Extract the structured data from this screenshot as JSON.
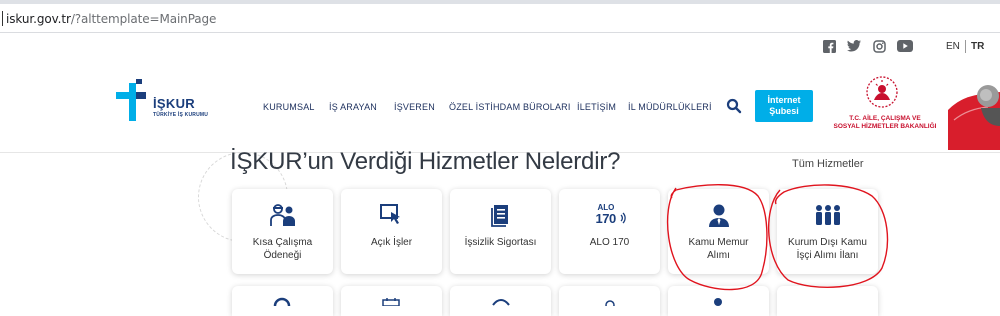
{
  "browser": {
    "url_host": "iskur.gov.tr",
    "url_path": "/?alttemplate=MainPage"
  },
  "topbar": {
    "social_icons": [
      "facebook-icon",
      "twitter-icon",
      "instagram-icon",
      "youtube-icon"
    ],
    "lang_en": "EN",
    "lang_tr": "TR"
  },
  "header": {
    "logo_word": "İŞKUR",
    "logo_sub": "TÜRKİYE İŞ KURUMU",
    "nav": [
      "KURUMSAL",
      "İŞ ARAYAN",
      "İŞVEREN",
      "ÖZEL İSTİHDAM BÜROLARI",
      "İLETİŞİM",
      "İL MÜDÜRLÜKLERİ"
    ],
    "eservice_line1": "İnternet",
    "eservice_line2": "Şubesi",
    "ministry_line1": "T.C. AİLE, ÇALIŞMA VE",
    "ministry_line2": "SOSYAL HİZMETLER BAKANLIĞI"
  },
  "main": {
    "heading": "İŞKUR’un Verdiği Hizmetler Nelerdir?",
    "all_services": "Tüm Hizmetler",
    "services": [
      {
        "line1": "Kısa Çalışma",
        "line2": "Ödeneği",
        "icon": "workers-icon"
      },
      {
        "line1": "Açık İşler",
        "line2": "",
        "icon": "cursor-click-icon"
      },
      {
        "line1": "İşsizlik Sigortası",
        "line2": "",
        "icon": "document-icon"
      },
      {
        "line1": "ALO 170",
        "line2": "",
        "icon": "alo170-icon",
        "icon_text_top": "ALO",
        "icon_text_bottom": "170"
      },
      {
        "line1": "Kamu Memur",
        "line2": "Alımı",
        "icon": "person-tie-icon"
      },
      {
        "line1": "Kurum Dışı Kamu",
        "line2": "İşçi Alımı İlanı",
        "icon": "group-icon"
      }
    ]
  },
  "colors": {
    "brand_blue": "#1b3e7c",
    "accent_cyan": "#00aee8",
    "ministry_red": "#c8102e",
    "annotation_red": "#e0141e"
  }
}
